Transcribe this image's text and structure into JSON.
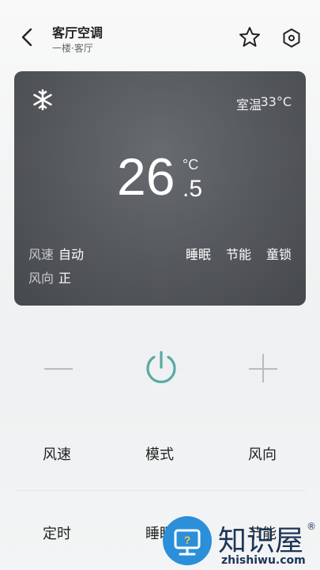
{
  "header": {
    "title": "客厅空调",
    "subtitle": "一楼·客厅"
  },
  "panel": {
    "room_label": "室温",
    "room_temp": "33°C",
    "set_temp_integer": "26",
    "set_temp_unit": "°C",
    "set_temp_decimal": ".5",
    "fan_speed_label": "风速",
    "fan_speed_value": "自动",
    "fan_direction_label": "风向",
    "fan_direction_value": "正",
    "flags": [
      "睡眠",
      "节能",
      "童锁"
    ]
  },
  "controls": {
    "row1": [
      "风速",
      "模式",
      "风向"
    ],
    "row2": [
      "定时",
      "睡眠",
      "节能"
    ]
  },
  "watermark": {
    "text": "知识屋",
    "reg": "®",
    "url": "zhishiwu.com"
  },
  "colors": {
    "panel_bg": "#55585c",
    "power_accent": "#5aa9a4",
    "watermark_blue": "#2b8fd9"
  },
  "icons": [
    "back-arrow-icon",
    "star-icon",
    "hexagon-settings-icon",
    "snowflake-icon",
    "minus-icon",
    "power-icon",
    "plus-icon"
  ]
}
